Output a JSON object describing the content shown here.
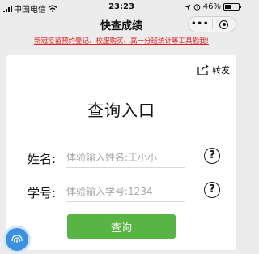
{
  "status_bar": {
    "carrier": "中国电信",
    "time": "23:23",
    "battery_text": "46%",
    "battery_level": 0.46
  },
  "nav": {
    "title": "快查成绩",
    "more": "•••"
  },
  "notice": {
    "text": "新冠疫苗预约登记、校服购买、高一分班统计等工具戳我!"
  },
  "card": {
    "share_label": "转发",
    "title": "查询入口",
    "name_row": {
      "label": "姓名:",
      "placeholder": "体验输入姓名:王小小"
    },
    "id_row": {
      "label": "学号:",
      "placeholder": "体验输入学号:1234"
    },
    "help_symbol": "?",
    "query_button": "查询"
  },
  "colors": {
    "accent_green": "#58b443",
    "notice_red": "#e02020",
    "fab_blue": "#3d8fe0"
  },
  "icons": [
    "signal-icon",
    "wifi-icon",
    "location-icon",
    "alarm-icon",
    "battery-icon",
    "more-icon",
    "close-icon",
    "share-icon",
    "help-icon",
    "fingerprint-icon"
  ]
}
